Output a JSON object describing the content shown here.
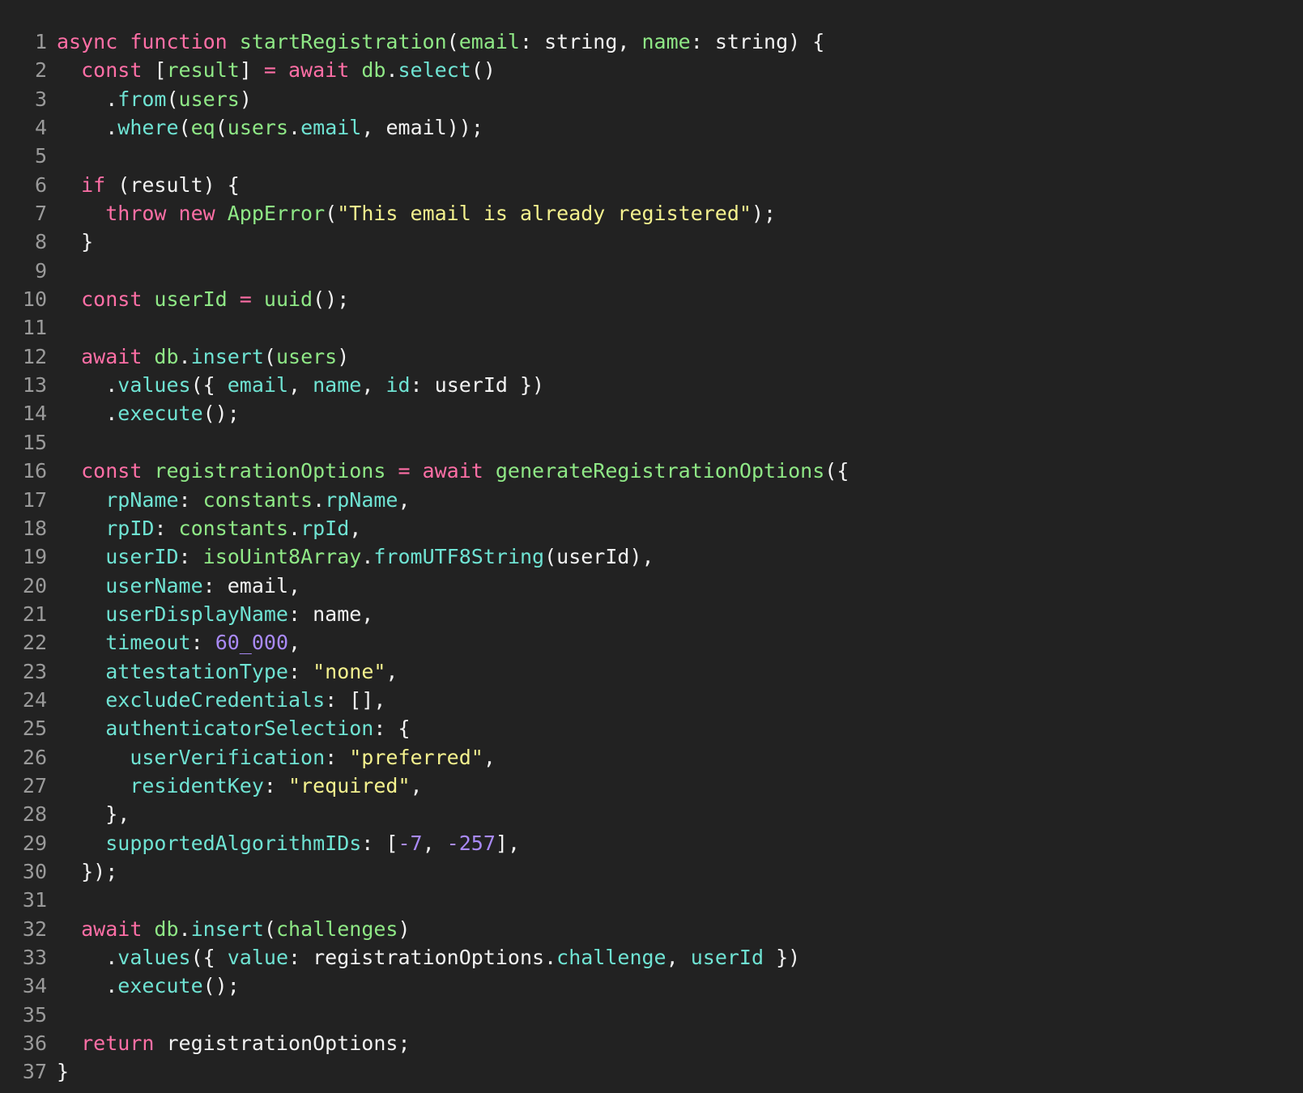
{
  "editor": {
    "lines": [
      [
        [
          "kw",
          "async "
        ],
        [
          "kw",
          "function "
        ],
        [
          "fn",
          "startRegistration"
        ],
        [
          "pl",
          "("
        ],
        [
          "id",
          "email"
        ],
        [
          "pl",
          ": string, "
        ],
        [
          "id",
          "name"
        ],
        [
          "pl",
          ": string) {"
        ]
      ],
      [
        [
          "pl",
          "  "
        ],
        [
          "kw",
          "const "
        ],
        [
          "pl",
          "["
        ],
        [
          "id",
          "result"
        ],
        [
          "pl",
          "] "
        ],
        [
          "kw",
          "= await "
        ],
        [
          "id",
          "db"
        ],
        [
          "pl",
          "."
        ],
        [
          "pr",
          "select"
        ],
        [
          "pl",
          "()"
        ]
      ],
      [
        [
          "pl",
          "    ."
        ],
        [
          "pr",
          "from"
        ],
        [
          "pl",
          "("
        ],
        [
          "id",
          "users"
        ],
        [
          "pl",
          ")"
        ]
      ],
      [
        [
          "pl",
          "    ."
        ],
        [
          "pr",
          "where"
        ],
        [
          "pl",
          "("
        ],
        [
          "fn",
          "eq"
        ],
        [
          "pl",
          "("
        ],
        [
          "id",
          "users"
        ],
        [
          "pl",
          "."
        ],
        [
          "pr",
          "email"
        ],
        [
          "pl",
          ", email));"
        ]
      ],
      [],
      [
        [
          "pl",
          "  "
        ],
        [
          "kw",
          "if "
        ],
        [
          "pl",
          "(result) {"
        ]
      ],
      [
        [
          "pl",
          "    "
        ],
        [
          "kw",
          "throw new "
        ],
        [
          "fn",
          "AppError"
        ],
        [
          "pl",
          "("
        ],
        [
          "str",
          "\"This email is already registered\""
        ],
        [
          "pl",
          ");"
        ]
      ],
      [
        [
          "pl",
          "  }"
        ]
      ],
      [],
      [
        [
          "pl",
          "  "
        ],
        [
          "kw",
          "const "
        ],
        [
          "id",
          "userId "
        ],
        [
          "kw",
          "= "
        ],
        [
          "fn",
          "uuid"
        ],
        [
          "pl",
          "();"
        ]
      ],
      [],
      [
        [
          "pl",
          "  "
        ],
        [
          "kw",
          "await "
        ],
        [
          "id",
          "db"
        ],
        [
          "pl",
          "."
        ],
        [
          "pr",
          "insert"
        ],
        [
          "pl",
          "("
        ],
        [
          "id",
          "users"
        ],
        [
          "pl",
          ")"
        ]
      ],
      [
        [
          "pl",
          "    ."
        ],
        [
          "pr",
          "values"
        ],
        [
          "pl",
          "({ "
        ],
        [
          "pr",
          "email"
        ],
        [
          "pl",
          ", "
        ],
        [
          "pr",
          "name"
        ],
        [
          "pl",
          ", "
        ],
        [
          "pr",
          "id"
        ],
        [
          "pl",
          ": userId })"
        ]
      ],
      [
        [
          "pl",
          "    ."
        ],
        [
          "pr",
          "execute"
        ],
        [
          "pl",
          "();"
        ]
      ],
      [],
      [
        [
          "pl",
          "  "
        ],
        [
          "kw",
          "const "
        ],
        [
          "id",
          "registrationOptions "
        ],
        [
          "kw",
          "= await "
        ],
        [
          "fn",
          "generateRegistrationOptions"
        ],
        [
          "pl",
          "({"
        ]
      ],
      [
        [
          "pl",
          "    "
        ],
        [
          "pr",
          "rpName"
        ],
        [
          "pl",
          ": "
        ],
        [
          "id",
          "constants"
        ],
        [
          "pl",
          "."
        ],
        [
          "pr",
          "rpName"
        ],
        [
          "pl",
          ","
        ]
      ],
      [
        [
          "pl",
          "    "
        ],
        [
          "pr",
          "rpID"
        ],
        [
          "pl",
          ": "
        ],
        [
          "id",
          "constants"
        ],
        [
          "pl",
          "."
        ],
        [
          "pr",
          "rpId"
        ],
        [
          "pl",
          ","
        ]
      ],
      [
        [
          "pl",
          "    "
        ],
        [
          "pr",
          "userID"
        ],
        [
          "pl",
          ": "
        ],
        [
          "id",
          "isoUint8Array"
        ],
        [
          "pl",
          "."
        ],
        [
          "pr",
          "fromUTF8String"
        ],
        [
          "pl",
          "(userId),"
        ]
      ],
      [
        [
          "pl",
          "    "
        ],
        [
          "pr",
          "userName"
        ],
        [
          "pl",
          ": email,"
        ]
      ],
      [
        [
          "pl",
          "    "
        ],
        [
          "pr",
          "userDisplayName"
        ],
        [
          "pl",
          ": name,"
        ]
      ],
      [
        [
          "pl",
          "    "
        ],
        [
          "pr",
          "timeout"
        ],
        [
          "pl",
          ": "
        ],
        [
          "num",
          "60_000"
        ],
        [
          "pl",
          ","
        ]
      ],
      [
        [
          "pl",
          "    "
        ],
        [
          "pr",
          "attestationType"
        ],
        [
          "pl",
          ": "
        ],
        [
          "str",
          "\"none\""
        ],
        [
          "pl",
          ","
        ]
      ],
      [
        [
          "pl",
          "    "
        ],
        [
          "pr",
          "excludeCredentials"
        ],
        [
          "pl",
          ": [],"
        ]
      ],
      [
        [
          "pl",
          "    "
        ],
        [
          "pr",
          "authenticatorSelection"
        ],
        [
          "pl",
          ": {"
        ]
      ],
      [
        [
          "pl",
          "      "
        ],
        [
          "pr",
          "userVerification"
        ],
        [
          "pl",
          ": "
        ],
        [
          "str",
          "\"preferred\""
        ],
        [
          "pl",
          ","
        ]
      ],
      [
        [
          "pl",
          "      "
        ],
        [
          "pr",
          "residentKey"
        ],
        [
          "pl",
          ": "
        ],
        [
          "str",
          "\"required\""
        ],
        [
          "pl",
          ","
        ]
      ],
      [
        [
          "pl",
          "    },"
        ]
      ],
      [
        [
          "pl",
          "    "
        ],
        [
          "pr",
          "supportedAlgorithmIDs"
        ],
        [
          "pl",
          ": ["
        ],
        [
          "num",
          "-7"
        ],
        [
          "pl",
          ", "
        ],
        [
          "num",
          "-257"
        ],
        [
          "pl",
          "],"
        ]
      ],
      [
        [
          "pl",
          "  });"
        ]
      ],
      [],
      [
        [
          "pl",
          "  "
        ],
        [
          "kw",
          "await "
        ],
        [
          "id",
          "db"
        ],
        [
          "pl",
          "."
        ],
        [
          "pr",
          "insert"
        ],
        [
          "pl",
          "("
        ],
        [
          "id",
          "challenges"
        ],
        [
          "pl",
          ")"
        ]
      ],
      [
        [
          "pl",
          "    ."
        ],
        [
          "pr",
          "values"
        ],
        [
          "pl",
          "({ "
        ],
        [
          "pr",
          "value"
        ],
        [
          "pl",
          ": registrationOptions."
        ],
        [
          "pr",
          "challenge"
        ],
        [
          "pl",
          ", "
        ],
        [
          "pr",
          "userId"
        ],
        [
          "pl",
          " })"
        ]
      ],
      [
        [
          "pl",
          "    ."
        ],
        [
          "pr",
          "execute"
        ],
        [
          "pl",
          "();"
        ]
      ],
      [],
      [
        [
          "pl",
          "  "
        ],
        [
          "kw",
          "return "
        ],
        [
          "pl",
          "registrationOptions;"
        ]
      ],
      [
        [
          "pl",
          "}"
        ]
      ]
    ]
  }
}
